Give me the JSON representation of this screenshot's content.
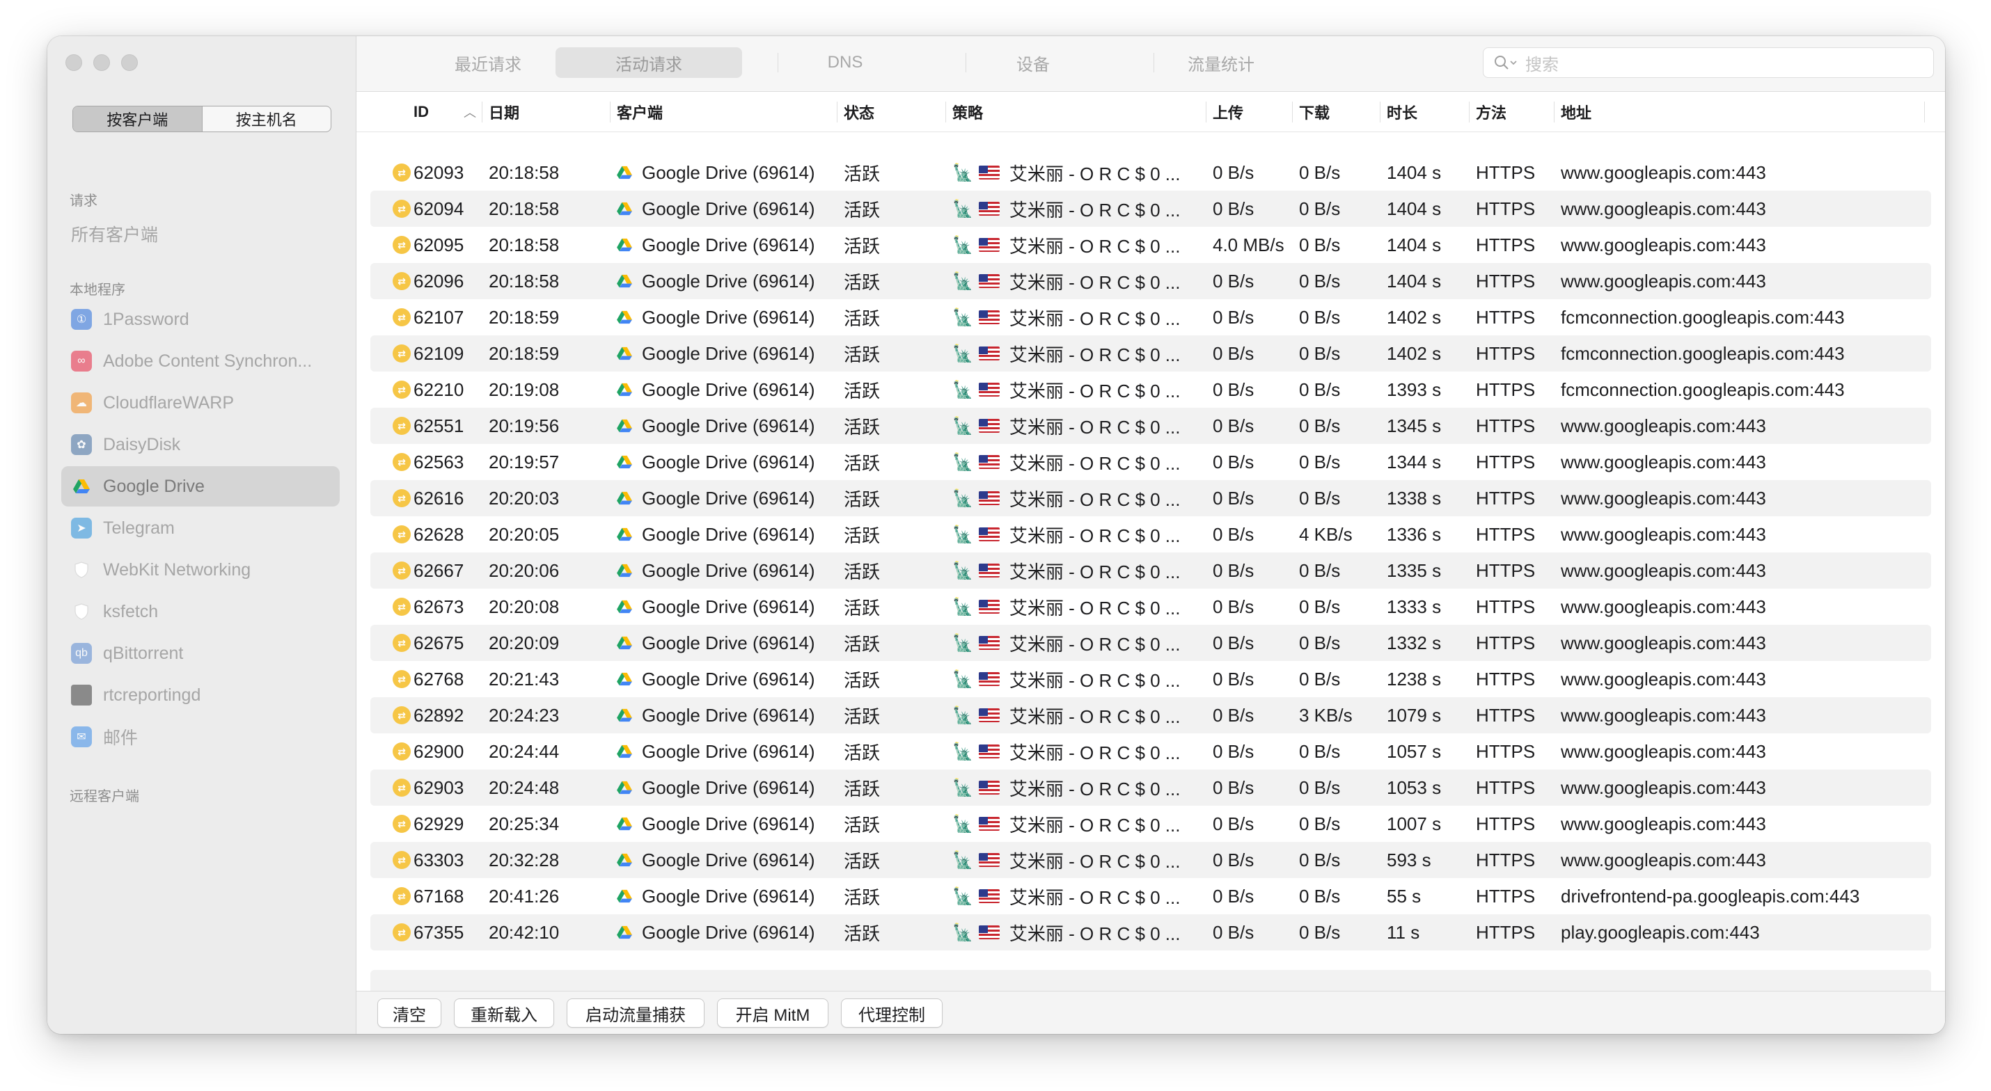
{
  "sidebar": {
    "segment": {
      "by_client": "按客户端",
      "by_host": "按主机名"
    },
    "section_requests": "请求",
    "all_clients": "所有客户端",
    "section_local": "本地程序",
    "section_remote": "远程客户端",
    "apps": [
      {
        "label": "1Password",
        "icon": "1password-icon",
        "color": "#5b8fe0",
        "glyph": "①"
      },
      {
        "label": "Adobe Content Synchron...",
        "icon": "adobe-creative-cloud-icon",
        "color": "#e8596e",
        "glyph": "∞"
      },
      {
        "label": "CloudflareWARP",
        "icon": "cloudflare-icon",
        "color": "#f2a450",
        "glyph": "☁"
      },
      {
        "label": "DaisyDisk",
        "icon": "daisydisk-icon",
        "color": "#6f8fb5",
        "glyph": "✿"
      },
      {
        "label": "Google Drive",
        "icon": "google-drive-icon",
        "color": "#ffffff",
        "glyph": ""
      },
      {
        "label": "Telegram",
        "icon": "telegram-icon",
        "color": "#5aa8e0",
        "glyph": "➤"
      },
      {
        "label": "WebKit Networking",
        "icon": "shield-icon",
        "color": "#f4f4f4",
        "glyph": ""
      },
      {
        "label": "ksfetch",
        "icon": "shield-icon",
        "color": "#f4f4f4",
        "glyph": ""
      },
      {
        "label": "qBittorrent",
        "icon": "qbittorrent-icon",
        "color": "#7fa3d8",
        "glyph": "qb"
      },
      {
        "label": "rtcreportingd",
        "icon": "terminal-icon",
        "color": "#8a8a8a",
        "glyph": ""
      },
      {
        "label": "邮件",
        "icon": "mail-icon",
        "color": "#6aa6ea",
        "glyph": "✉"
      }
    ]
  },
  "tabs": [
    "最近请求",
    "活动请求",
    "DNS",
    "设备",
    "流量统计"
  ],
  "active_tab": "活动请求",
  "search": {
    "placeholder": "搜索"
  },
  "columns": [
    "ID",
    "日期",
    "客户端",
    "状态",
    "策略",
    "上传",
    "下载",
    "时长",
    "方法",
    "地址"
  ],
  "rows": [
    {
      "id": "62093",
      "date": "20:18:58",
      "client": "Google Drive (69614)",
      "status": "活跃",
      "policy": "艾米丽 - O R C $ 0 ...",
      "up": "0 B/s",
      "down": "0 B/s",
      "dur": "1404 s",
      "method": "HTTPS",
      "addr": "www.googleapis.com:443"
    },
    {
      "id": "62094",
      "date": "20:18:58",
      "client": "Google Drive (69614)",
      "status": "活跃",
      "policy": "艾米丽 - O R C $ 0 ...",
      "up": "0 B/s",
      "down": "0 B/s",
      "dur": "1404 s",
      "method": "HTTPS",
      "addr": "www.googleapis.com:443"
    },
    {
      "id": "62095",
      "date": "20:18:58",
      "client": "Google Drive (69614)",
      "status": "活跃",
      "policy": "艾米丽 - O R C $ 0 ...",
      "up": "4.0 MB/s",
      "down": "0 B/s",
      "dur": "1404 s",
      "method": "HTTPS",
      "addr": "www.googleapis.com:443"
    },
    {
      "id": "62096",
      "date": "20:18:58",
      "client": "Google Drive (69614)",
      "status": "活跃",
      "policy": "艾米丽 - O R C $ 0 ...",
      "up": "0 B/s",
      "down": "0 B/s",
      "dur": "1404 s",
      "method": "HTTPS",
      "addr": "www.googleapis.com:443"
    },
    {
      "id": "62107",
      "date": "20:18:59",
      "client": "Google Drive (69614)",
      "status": "活跃",
      "policy": "艾米丽 - O R C $ 0 ...",
      "up": "0 B/s",
      "down": "0 B/s",
      "dur": "1402 s",
      "method": "HTTPS",
      "addr": "fcmconnection.googleapis.com:443"
    },
    {
      "id": "62109",
      "date": "20:18:59",
      "client": "Google Drive (69614)",
      "status": "活跃",
      "policy": "艾米丽 - O R C $ 0 ...",
      "up": "0 B/s",
      "down": "0 B/s",
      "dur": "1402 s",
      "method": "HTTPS",
      "addr": "fcmconnection.googleapis.com:443"
    },
    {
      "id": "62210",
      "date": "20:19:08",
      "client": "Google Drive (69614)",
      "status": "活跃",
      "policy": "艾米丽 - O R C $ 0 ...",
      "up": "0 B/s",
      "down": "0 B/s",
      "dur": "1393 s",
      "method": "HTTPS",
      "addr": "fcmconnection.googleapis.com:443"
    },
    {
      "id": "62551",
      "date": "20:19:56",
      "client": "Google Drive (69614)",
      "status": "活跃",
      "policy": "艾米丽 - O R C $ 0 ...",
      "up": "0 B/s",
      "down": "0 B/s",
      "dur": "1345 s",
      "method": "HTTPS",
      "addr": "www.googleapis.com:443"
    },
    {
      "id": "62563",
      "date": "20:19:57",
      "client": "Google Drive (69614)",
      "status": "活跃",
      "policy": "艾米丽 - O R C $ 0 ...",
      "up": "0 B/s",
      "down": "0 B/s",
      "dur": "1344 s",
      "method": "HTTPS",
      "addr": "www.googleapis.com:443"
    },
    {
      "id": "62616",
      "date": "20:20:03",
      "client": "Google Drive (69614)",
      "status": "活跃",
      "policy": "艾米丽 - O R C $ 0 ...",
      "up": "0 B/s",
      "down": "0 B/s",
      "dur": "1338 s",
      "method": "HTTPS",
      "addr": "www.googleapis.com:443"
    },
    {
      "id": "62628",
      "date": "20:20:05",
      "client": "Google Drive (69614)",
      "status": "活跃",
      "policy": "艾米丽 - O R C $ 0 ...",
      "up": "0 B/s",
      "down": "4 KB/s",
      "dur": "1336 s",
      "method": "HTTPS",
      "addr": "www.googleapis.com:443"
    },
    {
      "id": "62667",
      "date": "20:20:06",
      "client": "Google Drive (69614)",
      "status": "活跃",
      "policy": "艾米丽 - O R C $ 0 ...",
      "up": "0 B/s",
      "down": "0 B/s",
      "dur": "1335 s",
      "method": "HTTPS",
      "addr": "www.googleapis.com:443"
    },
    {
      "id": "62673",
      "date": "20:20:08",
      "client": "Google Drive (69614)",
      "status": "活跃",
      "policy": "艾米丽 - O R C $ 0 ...",
      "up": "0 B/s",
      "down": "0 B/s",
      "dur": "1333 s",
      "method": "HTTPS",
      "addr": "www.googleapis.com:443"
    },
    {
      "id": "62675",
      "date": "20:20:09",
      "client": "Google Drive (69614)",
      "status": "活跃",
      "policy": "艾米丽 - O R C $ 0 ...",
      "up": "0 B/s",
      "down": "0 B/s",
      "dur": "1332 s",
      "method": "HTTPS",
      "addr": "www.googleapis.com:443"
    },
    {
      "id": "62768",
      "date": "20:21:43",
      "client": "Google Drive (69614)",
      "status": "活跃",
      "policy": "艾米丽 - O R C $ 0 ...",
      "up": "0 B/s",
      "down": "0 B/s",
      "dur": "1238 s",
      "method": "HTTPS",
      "addr": "www.googleapis.com:443"
    },
    {
      "id": "62892",
      "date": "20:24:23",
      "client": "Google Drive (69614)",
      "status": "活跃",
      "policy": "艾米丽 - O R C $ 0 ...",
      "up": "0 B/s",
      "down": "3 KB/s",
      "dur": "1079 s",
      "method": "HTTPS",
      "addr": "www.googleapis.com:443"
    },
    {
      "id": "62900",
      "date": "20:24:44",
      "client": "Google Drive (69614)",
      "status": "活跃",
      "policy": "艾米丽 - O R C $ 0 ...",
      "up": "0 B/s",
      "down": "0 B/s",
      "dur": "1057 s",
      "method": "HTTPS",
      "addr": "www.googleapis.com:443"
    },
    {
      "id": "62903",
      "date": "20:24:48",
      "client": "Google Drive (69614)",
      "status": "活跃",
      "policy": "艾米丽 - O R C $ 0 ...",
      "up": "0 B/s",
      "down": "0 B/s",
      "dur": "1053 s",
      "method": "HTTPS",
      "addr": "www.googleapis.com:443"
    },
    {
      "id": "62929",
      "date": "20:25:34",
      "client": "Google Drive (69614)",
      "status": "活跃",
      "policy": "艾米丽 - O R C $ 0 ...",
      "up": "0 B/s",
      "down": "0 B/s",
      "dur": "1007 s",
      "method": "HTTPS",
      "addr": "www.googleapis.com:443"
    },
    {
      "id": "63303",
      "date": "20:32:28",
      "client": "Google Drive (69614)",
      "status": "活跃",
      "policy": "艾米丽 - O R C $ 0 ...",
      "up": "0 B/s",
      "down": "0 B/s",
      "dur": "593 s",
      "method": "HTTPS",
      "addr": "www.googleapis.com:443"
    },
    {
      "id": "67168",
      "date": "20:41:26",
      "client": "Google Drive (69614)",
      "status": "活跃",
      "policy": "艾米丽 - O R C $ 0 ...",
      "up": "0 B/s",
      "down": "0 B/s",
      "dur": "55 s",
      "method": "HTTPS",
      "addr": "drivefrontend-pa.googleapis.com:443"
    },
    {
      "id": "67355",
      "date": "20:42:10",
      "client": "Google Drive (69614)",
      "status": "活跃",
      "policy": "艾米丽 - O R C $ 0 ...",
      "up": "0 B/s",
      "down": "0 B/s",
      "dur": "11 s",
      "method": "HTTPS",
      "addr": "play.googleapis.com:443"
    }
  ],
  "buttons": [
    "清空",
    "重新载入",
    "启动流量捕获",
    "开启 MitM",
    "代理控制"
  ],
  "colors": {
    "status_active": "#f6c646",
    "row_alt": "#f2f2f2",
    "sidebar_bg": "#ececec"
  }
}
